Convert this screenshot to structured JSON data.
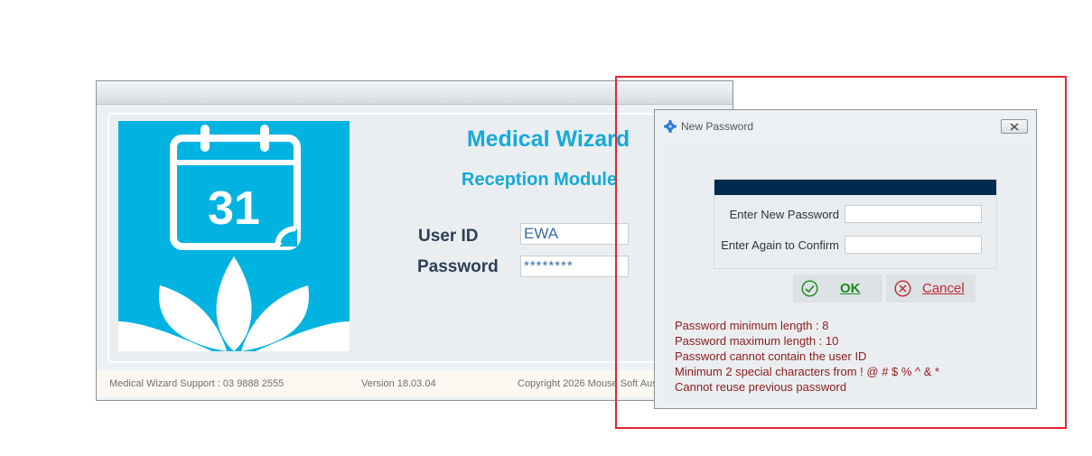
{
  "login": {
    "app_title": "Medical Wizard",
    "module_title": "Reception Module",
    "calendar_day": "31",
    "user_id_label": "User ID",
    "user_id_value": "EWA",
    "password_label": "Password",
    "password_value": "********",
    "footer": {
      "support": "Medical Wizard Support : 03 9888 2555",
      "version": "Version 18.03.04",
      "copyright": "Copyright 2026 Mouse Soft Aus"
    }
  },
  "dialog": {
    "title": "New Password",
    "close_icon": "close-icon",
    "new_password_label": "Enter New Password",
    "confirm_label": "Enter Again to Confirm",
    "new_password_value": "",
    "confirm_value": "",
    "ok_label": "OK",
    "cancel_label": "Cancel",
    "rules": [
      "Password minimum length : 8",
      "Password maximum length : 10",
      "Password cannot contain the user ID",
      "Minimum 2 special characters from ! @ # $ % ^ & *",
      "Cannot reuse previous password"
    ]
  },
  "colors": {
    "accent": "#16a9d9",
    "logo_background": "#00b3e1",
    "header_bar": "#002b4e",
    "rule_text": "#8b1c1c",
    "highlight": "#e3262e",
    "ok_green": "#1d8a1d",
    "cancel_red": "#c0282c"
  }
}
